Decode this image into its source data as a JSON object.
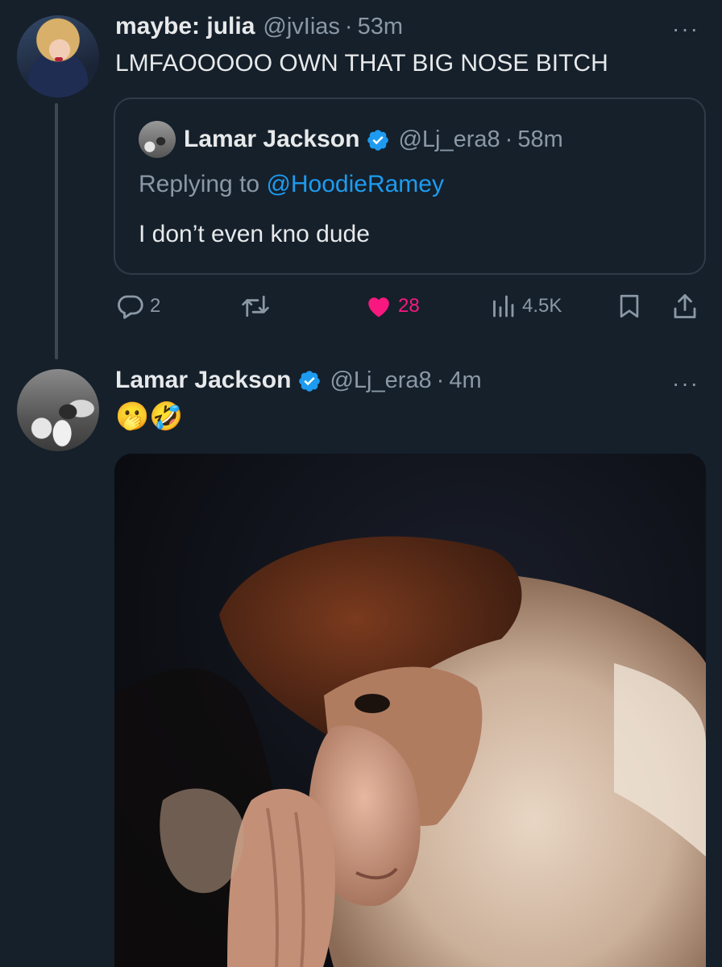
{
  "thread": {
    "tweet1": {
      "display_name": "maybe: julia",
      "handle": "@jvIias",
      "separator": "·",
      "time": "53m",
      "text": "LMFAOOOOO OWN THAT BIG NOSE BITCH",
      "more_label": "···",
      "quote": {
        "display_name": "Lamar Jackson",
        "handle": "@Lj_era8",
        "separator": "·",
        "time": "58m",
        "replying_prefix": "Replying to ",
        "replying_to": "@HoodieRamey",
        "text": "I don’t even kno dude"
      },
      "actions": {
        "replies": "2",
        "retweets": "",
        "likes": "28",
        "views": "4.5K"
      }
    },
    "tweet2": {
      "display_name": "Lamar Jackson",
      "handle": "@Lj_era8",
      "separator": "·",
      "time": "4m",
      "text": "🫢🤣",
      "more_label": "···",
      "media_description_icon": "proboscis-monkey-photo"
    }
  },
  "colors": {
    "background": "#15202b",
    "text_primary": "#e7e9ea",
    "text_secondary": "#8b98a5",
    "accent_blue": "#1d9bf0",
    "like_pink": "#f91880",
    "border": "#2f3b47"
  }
}
